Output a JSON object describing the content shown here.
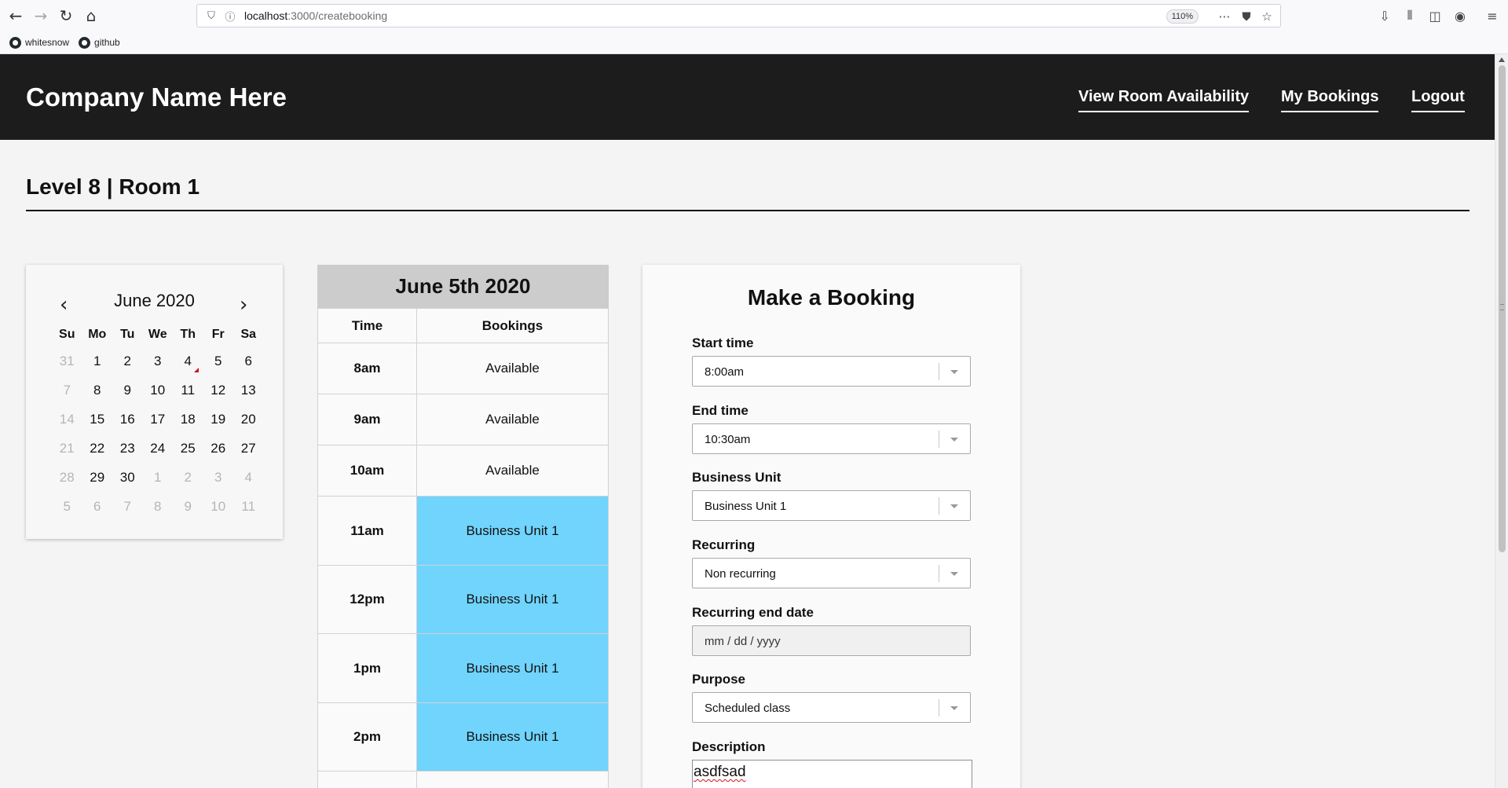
{
  "browser": {
    "url_host": "localhost",
    "url_path": ":3000/createbooking",
    "zoom": "110%",
    "bookmarks": [
      "whitesnow",
      "github"
    ]
  },
  "header": {
    "brand": "Company Name Here",
    "nav": [
      "View Room Availability",
      "My Bookings",
      "Logout"
    ]
  },
  "room_title": "Level 8 | Room 1",
  "calendar": {
    "prev": "‹",
    "next": "›",
    "month": "June 2020",
    "weekdays": [
      "Su",
      "Mo",
      "Tu",
      "We",
      "Th",
      "Fr",
      "Sa"
    ],
    "weeks": [
      [
        "31",
        "1",
        "2",
        "3",
        "4",
        "5",
        "6"
      ],
      [
        "7",
        "8",
        "9",
        "10",
        "11",
        "12",
        "13"
      ],
      [
        "14",
        "15",
        "16",
        "17",
        "18",
        "19",
        "20"
      ],
      [
        "21",
        "22",
        "23",
        "24",
        "25",
        "26",
        "27"
      ],
      [
        "28",
        "29",
        "30",
        "1",
        "2",
        "3",
        "4"
      ],
      [
        "5",
        "6",
        "7",
        "8",
        "9",
        "10",
        "11"
      ]
    ]
  },
  "schedule": {
    "date": "June 5th 2020",
    "col_time": "Time",
    "col_bookings": "Bookings",
    "rows": [
      {
        "time": "8am",
        "booking": "Available"
      },
      {
        "time": "9am",
        "booking": "Available"
      },
      {
        "time": "10am",
        "booking": "Available"
      },
      {
        "time": "11am",
        "booking": "Business Unit 1"
      },
      {
        "time": "12pm",
        "booking": "Business Unit 1"
      },
      {
        "time": "1pm",
        "booking": "Business Unit 1"
      },
      {
        "time": "2pm",
        "booking": "Business Unit 1"
      }
    ]
  },
  "form": {
    "title": "Make a Booking",
    "start_label": "Start time",
    "start_value": "8:00am",
    "end_label": "End time",
    "end_value": "10:30am",
    "unit_label": "Business Unit",
    "unit_value": "Business Unit 1",
    "recurring_label": "Recurring",
    "recurring_value": "Non recurring",
    "recurring_end_label": "Recurring end date",
    "recurring_end_placeholder": "mm / dd / yyyy",
    "purpose_label": "Purpose",
    "purpose_value": "Scheduled class",
    "description_label": "Description",
    "description_value": "asdfsad"
  },
  "colors": {
    "header_bg": "#1c1c1c",
    "booked": "#70d4fc",
    "table_header": "#cccccc"
  }
}
